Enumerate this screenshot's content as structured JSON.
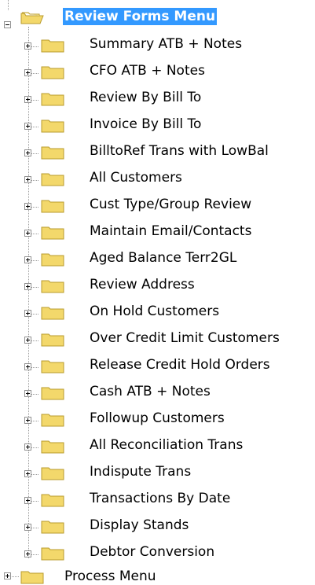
{
  "tree": {
    "root": {
      "label": "Review Forms Menu",
      "icon": "open-folder-icon",
      "expanded": true,
      "selected": true
    },
    "children": [
      {
        "label": "Summary ATB + Notes"
      },
      {
        "label": "CFO ATB + Notes"
      },
      {
        "label": "Review By Bill To"
      },
      {
        "label": "Invoice By Bill To"
      },
      {
        "label": "BilltoRef Trans with LowBal"
      },
      {
        "label": "All Customers"
      },
      {
        "label": "Cust Type/Group Review"
      },
      {
        "label": "Maintain Email/Contacts"
      },
      {
        "label": "Aged Balance Terr2GL"
      },
      {
        "label": "Review Address"
      },
      {
        "label": "On Hold Customers"
      },
      {
        "label": "Over Credit Limit Customers"
      },
      {
        "label": "Release Credit Hold Orders"
      },
      {
        "label": "Cash ATB + Notes"
      },
      {
        "label": "Followup Customers"
      },
      {
        "label": "All Reconciliation Trans"
      },
      {
        "label": "Indispute Trans"
      },
      {
        "label": "Transactions By Date"
      },
      {
        "label": "Display Stands"
      },
      {
        "label": "Debtor Conversion"
      }
    ],
    "next_sibling": {
      "label": "Process Menu"
    }
  },
  "colors": {
    "selection": "#3399ff",
    "folder_fill": "#f6e27a",
    "folder_edge": "#b89b2c",
    "tree_line": "#9b9b9b"
  }
}
